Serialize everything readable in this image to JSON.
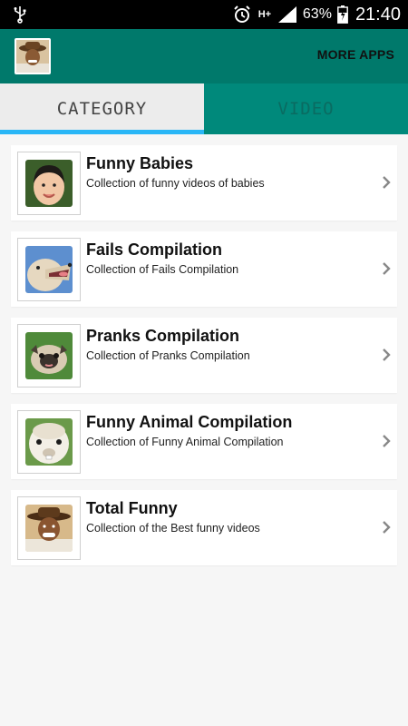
{
  "status_bar": {
    "battery_percent": "63%",
    "time": "21:40",
    "network": "H+",
    "icons": [
      "usb-icon",
      "alarm-icon",
      "signal-icon",
      "battery-icon"
    ]
  },
  "app_bar": {
    "more_apps_label": "MORE APPS",
    "color": "#00796b"
  },
  "tabs": [
    {
      "label": "CATEGORY",
      "active": true
    },
    {
      "label": "VIDEO",
      "active": false
    }
  ],
  "categories": [
    {
      "title": "Funny Babies",
      "description": "Collection of funny videos of babies",
      "thumb": "baby-thumbnail"
    },
    {
      "title": "Fails Compilation",
      "description": "Collection of Fails Compilation",
      "thumb": "dog-thumbnail"
    },
    {
      "title": "Pranks Compilation",
      "description": "Collection of Pranks Compilation",
      "thumb": "pug-thumbnail"
    },
    {
      "title": "Funny Animal Compilation",
      "description": "Collection of Funny Animal Compilation",
      "thumb": "alpaca-thumbnail"
    },
    {
      "title": "Total Funny",
      "description": "Collection of the Best funny videos",
      "thumb": "man-thumbnail"
    }
  ],
  "colors": {
    "app_bar": "#00796b",
    "tab_inactive": "#00897b",
    "tab_indicator": "#29b6f6",
    "background": "#f6f6f6"
  }
}
